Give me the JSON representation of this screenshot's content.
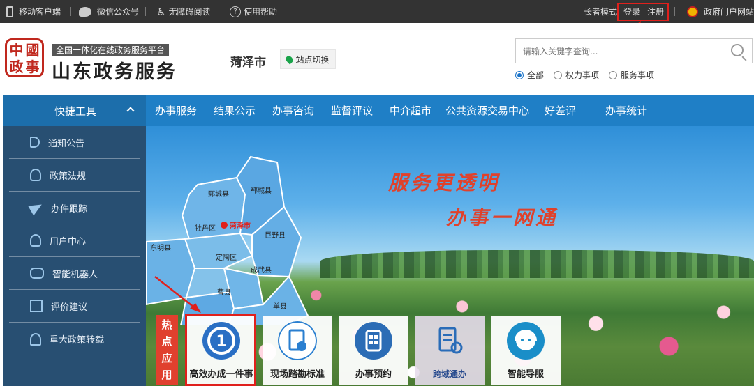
{
  "topbar": {
    "mobile": "移动客户端",
    "wechat": "微信公众号",
    "accessible": "无障碍阅读",
    "help": "使用帮助",
    "elder_mode": "长者模式",
    "login": "登录",
    "register": "注册",
    "gov_portal": "政府门户网站"
  },
  "header": {
    "seal_chars": [
      "中",
      "國",
      "政",
      "事"
    ],
    "platform_badge": "全国一体化在线政务服务平台",
    "brand_title": "山东政务服务",
    "city": "菏泽市",
    "switch_site": "站点切换",
    "search_placeholder": "请输入关键字查询...",
    "radios": [
      {
        "label": "全部",
        "checked": true
      },
      {
        "label": "权力事项",
        "checked": false
      },
      {
        "label": "服务事项",
        "checked": false
      }
    ]
  },
  "nav": {
    "quick_tools": "快捷工具",
    "items": [
      "办事服务",
      "结果公示",
      "办事咨询",
      "监督评议",
      "中介超市",
      "公共资源交易中心",
      "好差评",
      "办事统计"
    ]
  },
  "sidebar": {
    "items": [
      {
        "label": "通知公告",
        "icon": "speaker-icon"
      },
      {
        "label": "政策法规",
        "icon": "person-icon"
      },
      {
        "label": "办件跟踪",
        "icon": "paper-plane-icon"
      },
      {
        "label": "用户中心",
        "icon": "user-icon"
      },
      {
        "label": "智能机器人",
        "icon": "robot-icon"
      },
      {
        "label": "评价建议",
        "icon": "edit-icon"
      },
      {
        "label": "重大政策转载",
        "icon": "stamp-icon"
      }
    ]
  },
  "banner": {
    "slogan1": "服务更透明",
    "slogan2": "办事一网通",
    "map_labels": {
      "juancheng": "鄄城县",
      "yuncheng": "郓城县",
      "mudan": "牡丹区",
      "heze": "菏泽市",
      "juye": "巨野县",
      "dongming": "东明县",
      "dingtao": "定陶区",
      "chengwu": "成武县",
      "caoxian": "曹县",
      "shanxian": "单县"
    }
  },
  "hot_apps": {
    "label": "热点应用",
    "items": [
      {
        "label": "高效办成一件事",
        "icon": "one-thing-icon",
        "color": "#2a6fc4"
      },
      {
        "label": "现场踏勘标准",
        "icon": "document-stamp-icon",
        "color": "#2a7fd0"
      },
      {
        "label": "办事预约",
        "icon": "calendar-icon",
        "color": "#2b6cb5"
      },
      {
        "label": "跨域通办",
        "icon": "document-location-icon",
        "color": "#2a6cb8"
      },
      {
        "label": "智能导服",
        "icon": "headset-icon",
        "color": "#1a8ec8"
      }
    ]
  },
  "colors": {
    "nav_blue": "#1f7fc6",
    "quick_tools_blue": "#1c6eab",
    "highlight_red": "#e0201c",
    "slogan_red": "#e0412b",
    "hot_label_red": "#e0402e"
  }
}
